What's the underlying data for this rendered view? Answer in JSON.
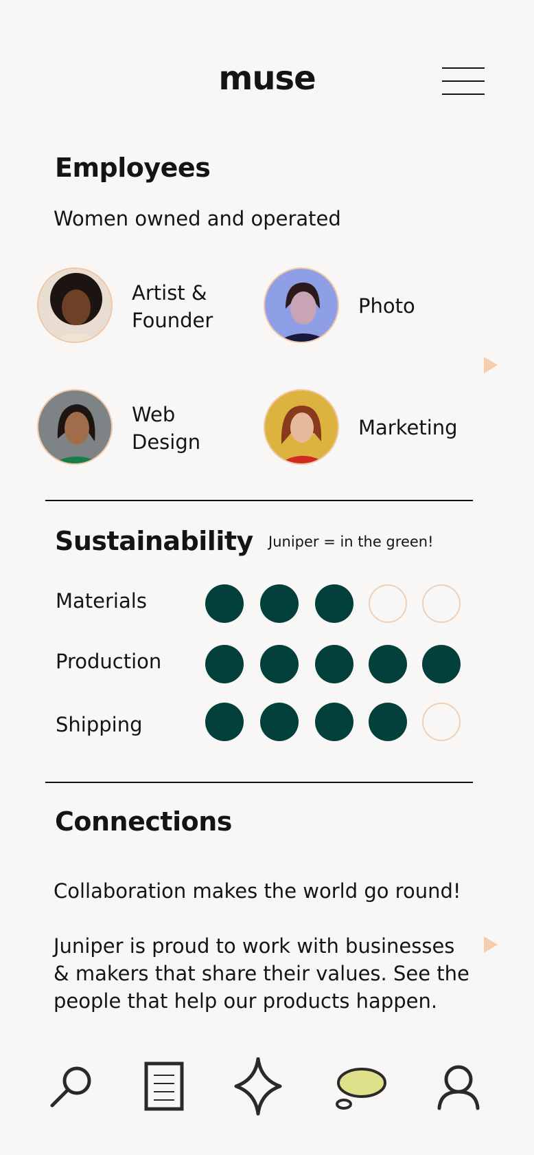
{
  "header": {
    "logo": "muse",
    "menu_icon": "hamburger-menu-icon"
  },
  "employees": {
    "title": "Employees",
    "subtitle": "Women owned and operated",
    "people": [
      {
        "line1": "Artist &",
        "line2": "Founder",
        "avatar": "portrait-1"
      },
      {
        "line1": "Photo",
        "line2": "",
        "avatar": "portrait-2"
      },
      {
        "line1": "Web",
        "line2": "Design",
        "avatar": "portrait-3"
      },
      {
        "line1": "Marketing",
        "line2": "",
        "avatar": "portrait-4"
      }
    ],
    "next_icon": "arrow-right-icon"
  },
  "sustainability": {
    "title": "Sustainability",
    "note": "Juniper = in the green!",
    "rows": [
      {
        "label": "Materials",
        "score": 3,
        "max": 5
      },
      {
        "label": "Production",
        "score": 5,
        "max": 5
      },
      {
        "label": "Shipping",
        "score": 4,
        "max": 5
      }
    ],
    "colors": {
      "filled": "#033f3b",
      "empty_border": "#f1cfb4"
    }
  },
  "connections": {
    "title": "Connections",
    "tagline": "Collaboration makes the world go round!",
    "para": [
      "Juniper is proud to work with businesses",
      "& makers that share their values. See the",
      "people that help our products happen."
    ],
    "next_icon": "arrow-right-icon"
  },
  "bottom_nav": [
    "search-icon",
    "document-icon",
    "sparkle-icon",
    "speech-bubble-icon",
    "profile-icon"
  ],
  "colors": {
    "background": "#f8f7f5",
    "accent_peach": "#f3cdae",
    "bubble": "#dfe08a"
  }
}
